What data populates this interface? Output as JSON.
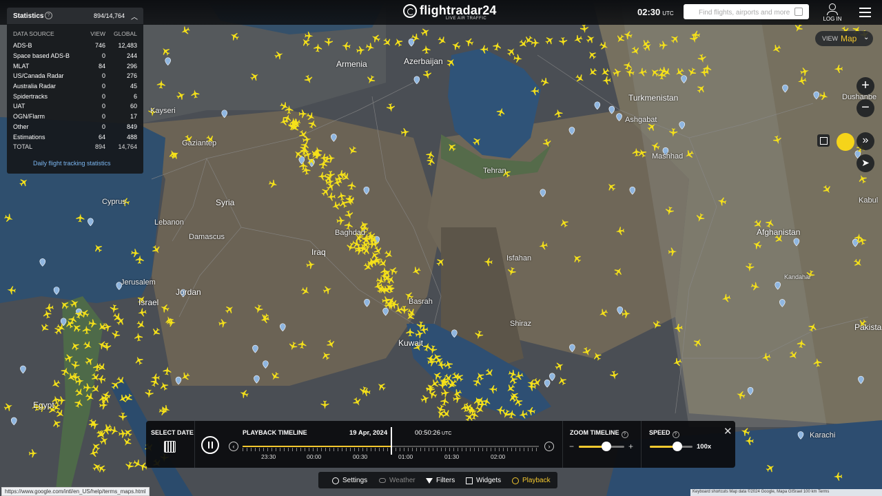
{
  "header": {
    "logo_text": "flightradar24",
    "logo_subtitle": "LIVE AIR TRAFFIC",
    "clock_time": "02:30",
    "clock_zone": "UTC",
    "search_placeholder": "Find flights, airports and more",
    "login_label": "LOG IN"
  },
  "stats": {
    "title": "Statistics",
    "count": "894/14,764",
    "columns": [
      "DATA SOURCE",
      "VIEW",
      "GLOBAL"
    ],
    "rows": [
      {
        "source": "ADS-B",
        "view": "746",
        "global": "12,483"
      },
      {
        "source": "Space based ADS-B",
        "view": "0",
        "global": "244"
      },
      {
        "source": "MLAT",
        "view": "84",
        "global": "296"
      },
      {
        "source": "US/Canada Radar",
        "view": "0",
        "global": "276"
      },
      {
        "source": "Australia Radar",
        "view": "0",
        "global": "45"
      },
      {
        "source": "Spidertracks",
        "view": "0",
        "global": "6"
      },
      {
        "source": "UAT",
        "view": "0",
        "global": "60"
      },
      {
        "source": "OGN/Flarm",
        "view": "0",
        "global": "17"
      },
      {
        "source": "Other",
        "view": "0",
        "global": "849"
      },
      {
        "source": "Estimations",
        "view": "64",
        "global": "488"
      },
      {
        "source": "TOTAL",
        "view": "894",
        "global": "14,764"
      }
    ],
    "link": "Daily flight tracking statistics"
  },
  "view_toggle": {
    "label": "VIEW",
    "value": "Map"
  },
  "map_labels": [
    {
      "text": "Armenia"
    },
    {
      "text": "Azerbaijan"
    },
    {
      "text": "Turkmenistan"
    },
    {
      "text": "Syria"
    },
    {
      "text": "Iraq"
    },
    {
      "text": "Jordan"
    },
    {
      "text": "Israel"
    },
    {
      "text": "Lebanon"
    },
    {
      "text": "Damascus"
    },
    {
      "text": "Baghdad"
    },
    {
      "text": "Tehran"
    },
    {
      "text": "Isfahan"
    },
    {
      "text": "Shiraz"
    },
    {
      "text": "Basrah"
    },
    {
      "text": "Kuwait"
    },
    {
      "text": "Mashhad"
    },
    {
      "text": "Afghanistan"
    },
    {
      "text": "Kabul"
    },
    {
      "text": "Kandahar"
    },
    {
      "text": "Egypt"
    },
    {
      "text": "Cyprus"
    },
    {
      "text": "Jerusalem"
    },
    {
      "text": "Gaziantep"
    },
    {
      "text": "Kayseri"
    },
    {
      "text": "Ashgabat"
    },
    {
      "text": "Karachi"
    },
    {
      "text": "Dushanbe"
    },
    {
      "text": "Pakista"
    }
  ],
  "playback": {
    "select_date_label": "SELECT DATE",
    "timeline_label": "PLAYBACK TIMELINE",
    "date": "19 Apr, 2024",
    "time": "00:50:26",
    "time_zone": "UTC",
    "progress": 0.5,
    "tick_labels": [
      "23:30",
      "00:00",
      "00:30",
      "01:00",
      "01:30",
      "02:00"
    ],
    "zoom_label": "ZOOM TIMELINE",
    "zoom_level": 0.6,
    "speed_label": "SPEED",
    "speed_value": "100x",
    "speed_level": 0.65
  },
  "bottom_bar": [
    {
      "label": "Settings",
      "icon": "gear-icon"
    },
    {
      "label": "Weather",
      "icon": "cloud-icon"
    },
    {
      "label": "Filters",
      "icon": "filter-icon"
    },
    {
      "label": "Widgets",
      "icon": "widgets-icon"
    },
    {
      "label": "Playback",
      "icon": "playback-icon"
    }
  ],
  "status_url": "https://www.google.com/intl/en_US/help/terms_maps.html",
  "attribution": "Keyboard shortcuts   Map data ©2024 Google, Mapa GISrael   100 km   Terms",
  "colors": {
    "accent": "#f5c92f",
    "aircraft": "#f5e11a",
    "panel": "#16181b"
  }
}
